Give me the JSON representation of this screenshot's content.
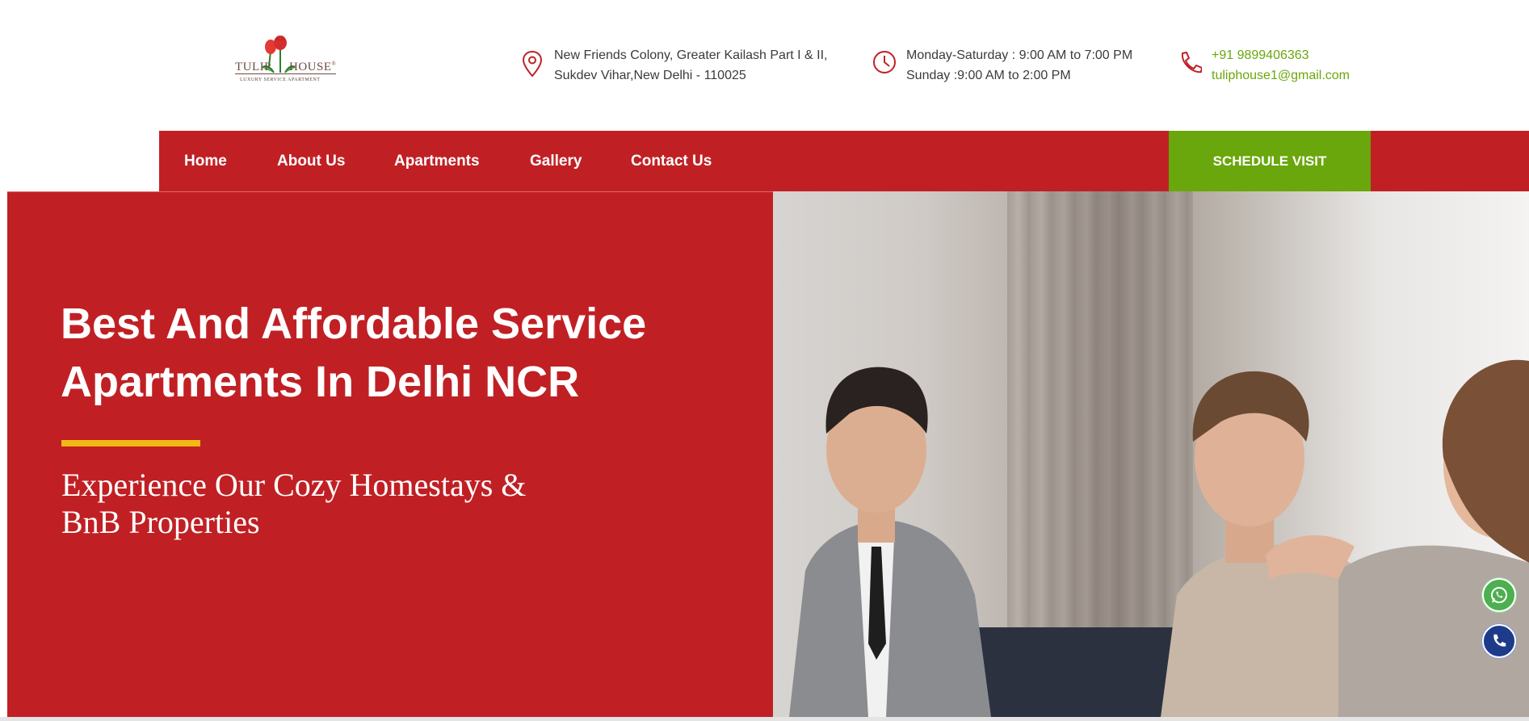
{
  "logo": {
    "brand_left": "TULIP",
    "brand_right": "HOUSE",
    "registered": "®",
    "tagline": "LUXURY SERVICE APARTMENT"
  },
  "header": {
    "address": {
      "icon": "location-pin-icon",
      "line1": "New Friends Colony, Greater Kailash Part I & II,",
      "line2": "Sukdev Vihar,New Delhi - 110025"
    },
    "hours": {
      "icon": "clock-icon",
      "line1": "Monday-Saturday : 9:00 AM to 7:00 PM",
      "line2": "Sunday :9:00 AM to 2:00 PM"
    },
    "contact": {
      "icon": "phone-icon",
      "phone": "+91 9899406363",
      "email": "tuliphouse1@gmail.com"
    }
  },
  "nav": {
    "items": [
      {
        "label": "Home"
      },
      {
        "label": "About Us"
      },
      {
        "label": "Apartments"
      },
      {
        "label": "Gallery"
      },
      {
        "label": "Contact Us"
      }
    ],
    "cta": "SCHEDULE VISIT"
  },
  "hero": {
    "title_line1": "Best And Affordable Service",
    "title_line2": "Apartments In Delhi NCR",
    "subtitle_line1": "Experience Our Cozy Homestays &",
    "subtitle_line2": "BnB Properties"
  },
  "floating": {
    "whatsapp_icon": "whatsapp-icon",
    "call_icon": "phone-call-icon"
  },
  "colors": {
    "brand_red": "#c02024",
    "cta_green": "#69a70c",
    "accent_yellow": "#f3b816",
    "call_blue": "#1e3a8a",
    "contact_green": "#6aa70b"
  }
}
